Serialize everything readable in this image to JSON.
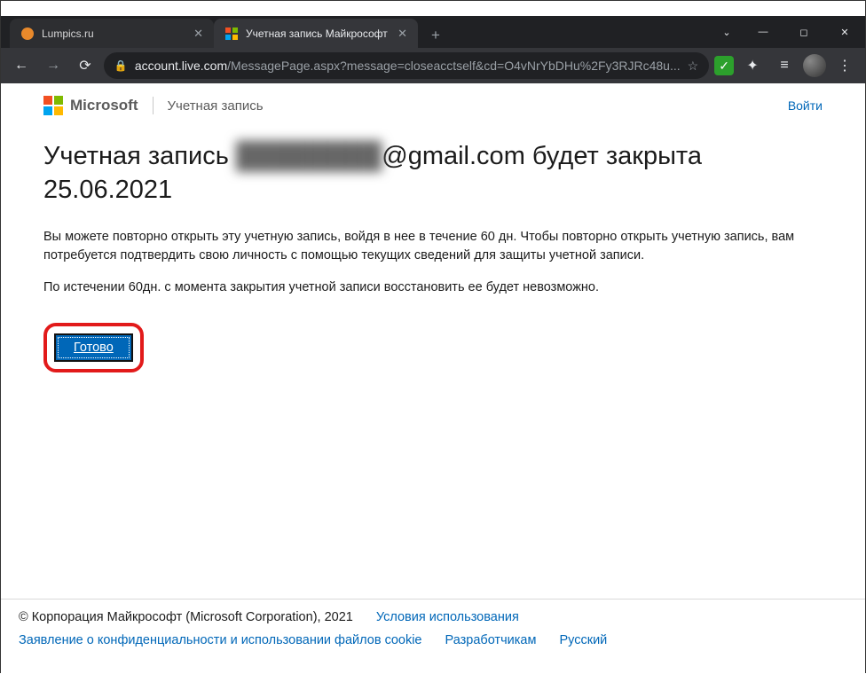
{
  "chrome": {
    "tabs": [
      {
        "title": "Lumpics.ru",
        "active": false
      },
      {
        "title": "Учетная запись Майкрософт",
        "active": true
      }
    ],
    "url_host": "account.live.com",
    "url_path": "/MessagePage.aspx?message=closeacctself&cd=O4vNrYbDHu%2Fy3RJRc48u...",
    "nav": {
      "back": "←",
      "forward": "→",
      "reload": "⟳"
    },
    "new_tab": "+",
    "win": {
      "chev": "⌄",
      "min": "—",
      "max": "◻",
      "close": "✕"
    },
    "omni": {
      "lock": "🔒",
      "star": "☆"
    },
    "ext_check": "✓",
    "puzzle": "✦",
    "playlist_icon": "≡",
    "menu": "⋮"
  },
  "header": {
    "brand": "Microsoft",
    "subtitle": "Учетная запись",
    "signin": "Войти"
  },
  "title": {
    "prefix": "Учетная запись ",
    "blurred": "████████",
    "email_suffix": "@gmail.com",
    "suffix": " будет закрыта 25.06.2021"
  },
  "para1": "Вы можете повторно открыть эту учетную запись, войдя в нее в течение 60 дн. Чтобы повторно открыть учетную запись, вам потребуется подтвердить свою личность с помощью текущих сведений для защиты учетной записи.",
  "para2": "По истечении 60дн. с момента закрытия учетной записи восстановить ее будет невозможно.",
  "button": "Готово",
  "footer": {
    "copyright": "© Корпорация Майкрософт (Microsoft Corporation), 2021",
    "terms": "Условия использования",
    "privacy": "Заявление о конфиденциальности и использовании файлов cookie",
    "devs": "Разработчикам",
    "lang": "Русский"
  }
}
